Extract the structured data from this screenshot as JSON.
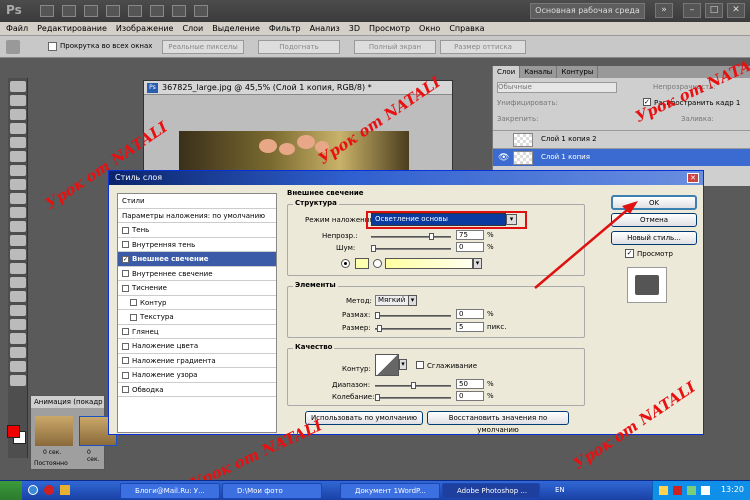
{
  "app": {
    "logo": "Ps",
    "workspace": "Основная рабочая среда",
    "win_controls": [
      "–",
      "□",
      "✕"
    ]
  },
  "menu": [
    "Файл",
    "Редактирование",
    "Изображение",
    "Слои",
    "Выделение",
    "Фильтр",
    "Анализ",
    "3D",
    "Просмотр",
    "Окно",
    "Справка"
  ],
  "options": {
    "scroll_all": "Прокрутка во всех окнах",
    "buttons": [
      "Реальные пикселы",
      "Подогнать",
      "Полный экран",
      "Размер оттиска"
    ]
  },
  "document": {
    "title": "367825_large.jpg @ 45,5% (Слой 1 копия, RGB/8) *"
  },
  "animation": {
    "title": "Анимация (покадр",
    "frame_times": [
      "0 сек.",
      "0 сек."
    ],
    "loop": "Постоянно"
  },
  "layers_panel": {
    "tabs": [
      "Слои",
      "Каналы",
      "Контуры"
    ],
    "blend": "Обычные",
    "opacity_label": "Непрозрачность:",
    "unify_label": "Унифицировать:",
    "propagate": "Распространить кадр 1",
    "lock_label": "Закрепить:",
    "fill_label": "Заливка:",
    "layers": [
      "Слой 1 копия 2",
      "Слой 1 копия"
    ]
  },
  "dialog": {
    "title": "Стиль слоя",
    "styles": [
      {
        "label": "Стили",
        "check": false
      },
      {
        "label": "Параметры наложения: по умолчанию",
        "check": false
      },
      {
        "label": "Тень",
        "check": true
      },
      {
        "label": "Внутренняя тень",
        "check": true
      },
      {
        "label": "Внешнее свечение",
        "check": true,
        "selected": true
      },
      {
        "label": "Внутреннее свечение",
        "check": true
      },
      {
        "label": "Тиснение",
        "check": true
      },
      {
        "label": "Контур",
        "check": true,
        "indent": true
      },
      {
        "label": "Текстура",
        "check": true,
        "indent": true
      },
      {
        "label": "Глянец",
        "check": true
      },
      {
        "label": "Наложение цвета",
        "check": true
      },
      {
        "label": "Наложение градиента",
        "check": true
      },
      {
        "label": "Наложение узора",
        "check": true
      },
      {
        "label": "Обводка",
        "check": true
      }
    ],
    "section_title": "Внешнее свечение",
    "structure": {
      "title": "Структура",
      "blend_label": "Режим наложения:",
      "blend_value": "Осветление основы",
      "opacity_label": "Непрозр.:",
      "opacity_value": "75",
      "noise_label": "Шум:",
      "noise_value": "0",
      "percent": "%"
    },
    "elements": {
      "title": "Элементы",
      "method_label": "Метод:",
      "method_value": "Мягкий",
      "spread_label": "Размах:",
      "spread_value": "0",
      "size_label": "Размер:",
      "size_value": "5",
      "size_unit": "пикс.",
      "percent": "%"
    },
    "quality": {
      "title": "Качество",
      "contour_label": "Контур:",
      "antialias_label": "Сглаживание",
      "range_label": "Диапазон:",
      "range_value": "50",
      "jitter_label": "Колебание:",
      "jitter_value": "0",
      "percent": "%"
    },
    "default_buttons": [
      "Использовать по умолчанию",
      "Восстановить значения по умолчанию"
    ],
    "buttons": {
      "ok": "OK",
      "cancel": "Отмена",
      "new_style": "Новый стиль...",
      "preview": "Просмотр"
    }
  },
  "watermarks": [
    "Урок от NATALI",
    "Урок от NATALI",
    "Урок от NATALI",
    "Урок от NATALI",
    "Урок от NATALI"
  ],
  "taskbar": {
    "tasks": [
      "Блоги@Mail.Ru: У...",
      "D:\\Мои фото",
      "Документ 1WordP...",
      "Adobe Photoshop ..."
    ],
    "lang": "EN",
    "clock": "13:20"
  },
  "colors": {
    "accent": "#3b5ba8",
    "callout": "#e01010",
    "watermark": "#e81010"
  }
}
